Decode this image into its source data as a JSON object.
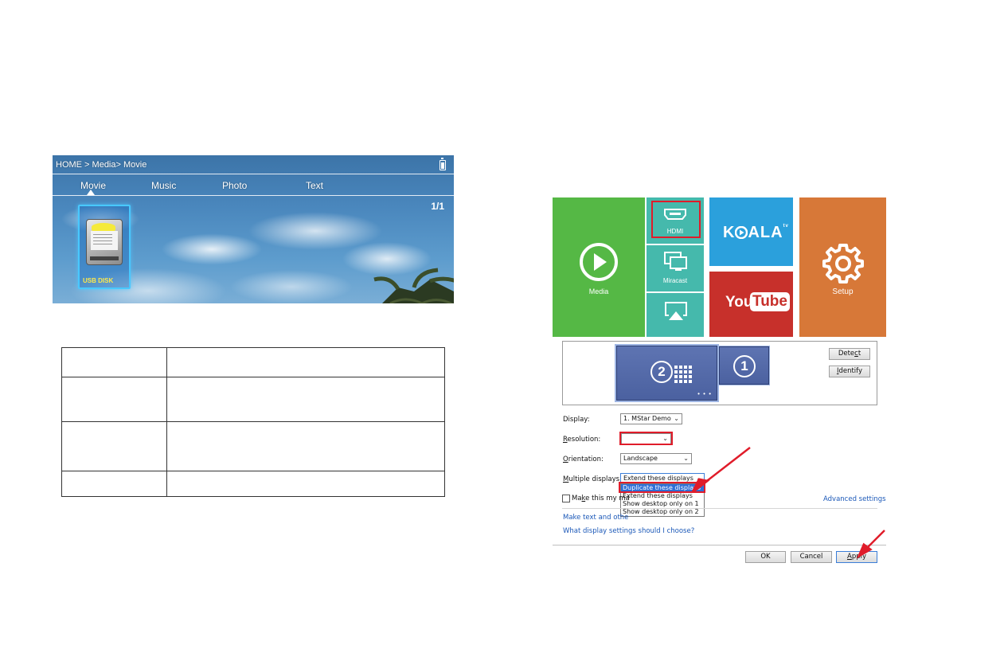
{
  "projector_media": {
    "breadcrumb": "HOME > Media> Movie",
    "tabs": [
      "Movie",
      "Music",
      "Photo",
      "Text"
    ],
    "active_tab": "Movie",
    "page_count": "1/1",
    "usb_label": "USB DISK"
  },
  "table": {
    "rows": 4,
    "cols": 2
  },
  "home_tiles": {
    "media": "Media",
    "hdmi": "HDMI",
    "miracast": "Miracast",
    "koala": "K",
    "koala_rest": "ALA",
    "koala_tv": "tv",
    "youtube_you": "You",
    "youtube_tube": "Tube",
    "setup": "Setup",
    "colors": {
      "media": "#55b845",
      "teal": "#45b9ac",
      "koala": "#2ba0dc",
      "youtube": "#c7302b",
      "setup": "#d77838",
      "highlight": "#e01c2a"
    }
  },
  "display_settings": {
    "monitor_2": "2",
    "monitor_1": "1",
    "detect_pre": "Dete",
    "detect_key": "c",
    "detect_post": "t",
    "identify_pre": "",
    "identify_key": "I",
    "identify_post": "dentify",
    "display_label": "Display:",
    "display_value": "1. MStar Demo",
    "resolution_key": "R",
    "resolution_rest": "esolution:",
    "resolution_value": "",
    "orientation_key": "O",
    "orientation_rest": "rientation:",
    "orientation_value": "Landscape",
    "multiple_key": "M",
    "multiple_rest": "ultiple displays:",
    "multiple_value": "Extend these displays",
    "dropdown_options": [
      "Duplicate these displays",
      "Extend these displays",
      "Show desktop only on 1",
      "Show desktop only on 2"
    ],
    "selected_option": "Duplicate these displays",
    "make_main_pre": "Ma",
    "make_main_key": "k",
    "make_main_post": "e this my ma",
    "advanced_settings": "Advanced settings",
    "make_text_link": "Make text and othe",
    "what_link": "What display settings should I choose?",
    "ok": "OK",
    "cancel": "Cancel",
    "apply_key": "A",
    "apply_rest": "pply"
  }
}
